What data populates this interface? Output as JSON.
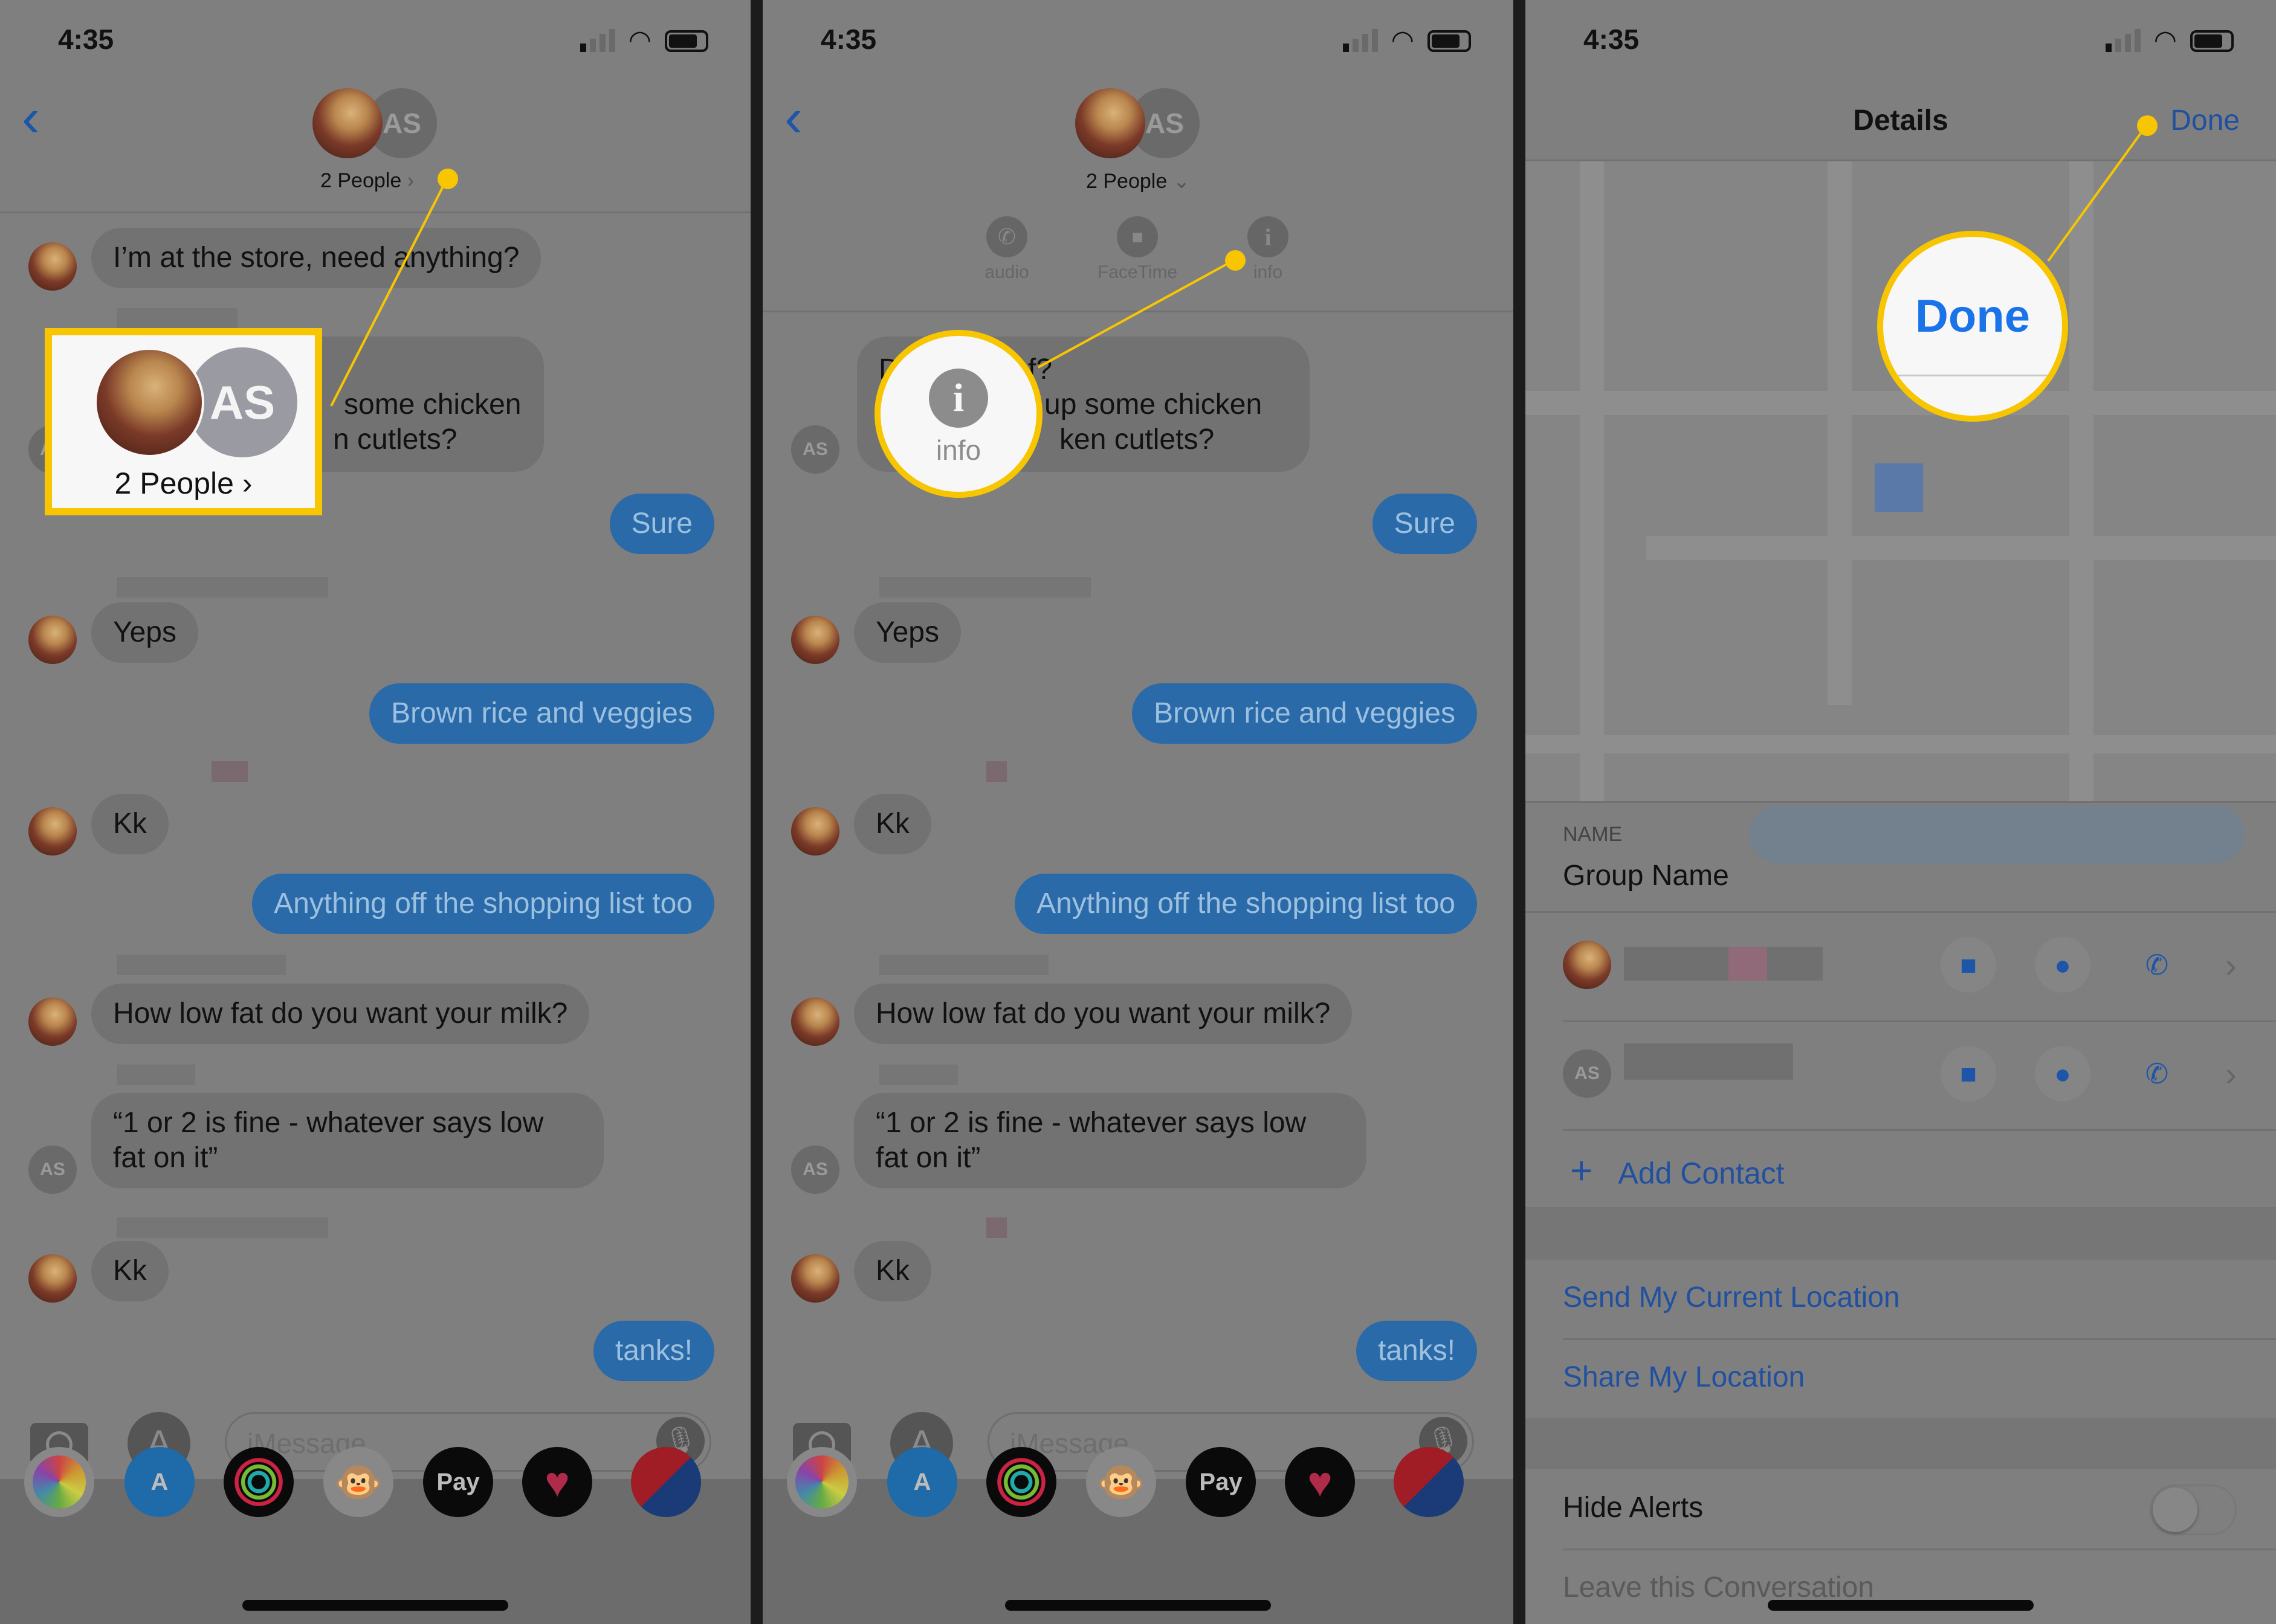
{
  "status": {
    "time": "4:35"
  },
  "conversation": {
    "header_label": "2 People",
    "header_chevron": "›",
    "header_chevron_down": "⌄",
    "avatar_initials": "AS",
    "messages": {
      "m1": "I’m at the store, need anything?",
      "m2_frag_a": "D",
      "m2_frag_b": "f?",
      "m2_line2_p1": "some chicken",
      "m2_line3_p1": "n cutlets?",
      "m2_line2_p2": "up some chicken",
      "m2_line3_p2": "ken cutlets?",
      "m3": "Sure",
      "m4": "Yeps",
      "m5": "Brown rice and veggies",
      "m6": "Kk",
      "m7": "Anything off the shopping list too",
      "m8": "How low fat do you want your milk?",
      "m9_l1": "“1 or 2 is fine - whatever says low",
      "m9_l2": "fat on it”",
      "m10": "Kk",
      "m11": "tanks!"
    },
    "input_placeholder": "iMessage",
    "apps": [
      "photos",
      "app-store",
      "activity",
      "animoji",
      "apple-pay",
      "digital-touch",
      "delta"
    ],
    "apple_pay_label": "Pay"
  },
  "actions": {
    "audio": "audio",
    "facetime": "FaceTime",
    "info": "info",
    "info_glyph": "i"
  },
  "callouts": {
    "people": "2 People ›",
    "info": "info",
    "done": "Done"
  },
  "details": {
    "title": "Details",
    "done": "Done",
    "name_label": "NAME",
    "name_placeholder": "Group Name",
    "add_contact": "Add Contact",
    "add_icon": "+",
    "send_location": "Send My Current Location",
    "share_location": "Share My Location",
    "hide_alerts": "Hide Alerts",
    "hide_alerts_on": false,
    "leave": "Leave this Conversation"
  },
  "colors": {
    "accent_yellow": "#f7c600",
    "ios_blue": "#2150a0",
    "overlay": "#7f7f7f"
  }
}
